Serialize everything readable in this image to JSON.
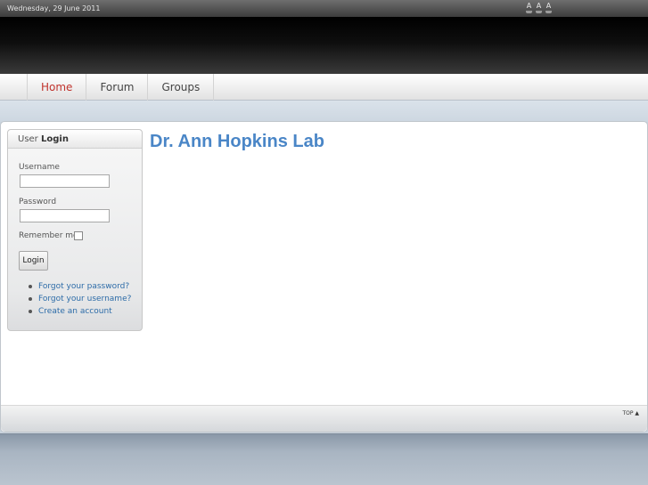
{
  "topbar": {
    "date": "Wednesday, 29 June 2011",
    "font_sizes": [
      "A",
      "A",
      "A"
    ]
  },
  "nav": {
    "items": [
      {
        "label": "Home",
        "active": true
      },
      {
        "label": "Forum",
        "active": false
      },
      {
        "label": "Groups",
        "active": false
      }
    ]
  },
  "login": {
    "title_prefix": "User",
    "title_bold": "Login",
    "username_label": "Username",
    "username_value": "",
    "password_label": "Password",
    "password_value": "",
    "remember_label": "Remember me",
    "remember_checked": false,
    "button_label": "Login",
    "links": [
      "Forgot your password?",
      "Forgot your username?",
      "Create an account"
    ]
  },
  "main": {
    "title": "Dr. Ann Hopkins Lab"
  },
  "footer": {
    "top_link": "TOP ▲"
  },
  "colors": {
    "accent": "#4a86c7",
    "nav_active": "#c0332d",
    "link": "#2d6ca8"
  }
}
